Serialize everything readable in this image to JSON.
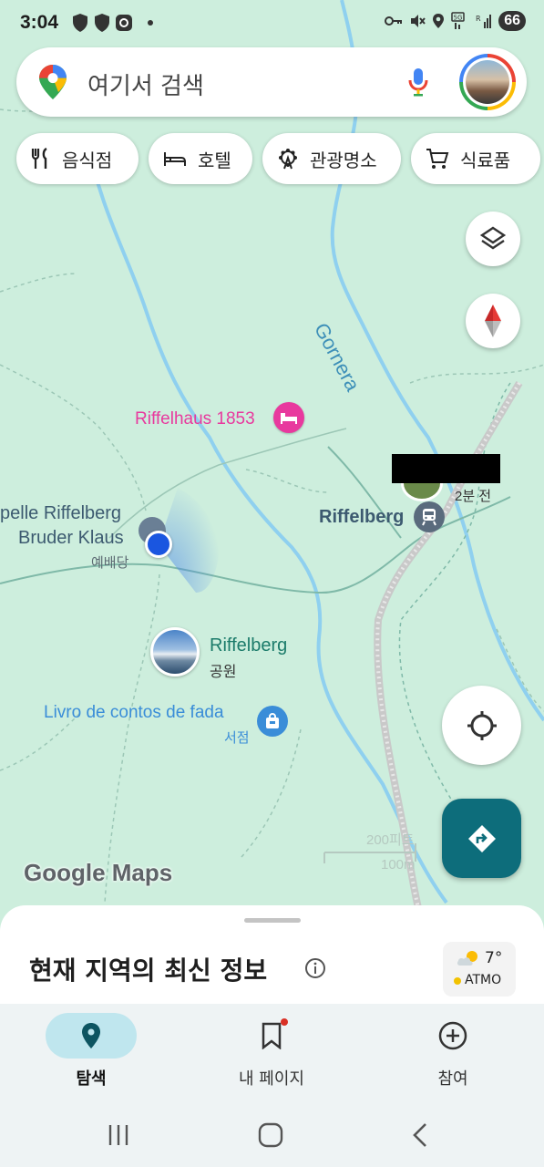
{
  "status_bar": {
    "time": "3:04",
    "battery": "66"
  },
  "search": {
    "placeholder": "여기서 검색"
  },
  "chips": [
    {
      "label": "음식점",
      "icon": "fork-knife-icon"
    },
    {
      "label": "호텔",
      "icon": "bed-icon"
    },
    {
      "label": "관광명소",
      "icon": "ferris-wheel-icon"
    },
    {
      "label": "식료품",
      "icon": "cart-icon"
    }
  ],
  "map": {
    "labels": {
      "river": "Gornera",
      "hotel": "Riffelhaus 1853",
      "chapel_line1": "pelle Riffelberg",
      "chapel_line2": "Bruder Klaus",
      "chapel_type": "예배당",
      "station": "Riffelberg",
      "time_ago": "2분 전",
      "park_name": "Riffelberg",
      "park_type": "공원",
      "store_name": "Livro de contos de fada",
      "store_type": "서점",
      "scale_200ft": "200피트",
      "scale_100m": "100m"
    },
    "brand": "Google Maps"
  },
  "sheet": {
    "title": "현재 지역의 최신 정보"
  },
  "weather": {
    "temp": "7°",
    "label": "ATMO"
  },
  "bottom_nav": {
    "explore": "탐색",
    "mypage": "내 페이지",
    "contribute": "참여"
  },
  "colors": {
    "accent": "#0d6d7b",
    "map_bg": "#cdeedd",
    "water": "#8fd0ef",
    "hotel_pink": "#e8399e",
    "store_blue": "#3a8dd8",
    "poi_green": "#1b7b6a"
  }
}
